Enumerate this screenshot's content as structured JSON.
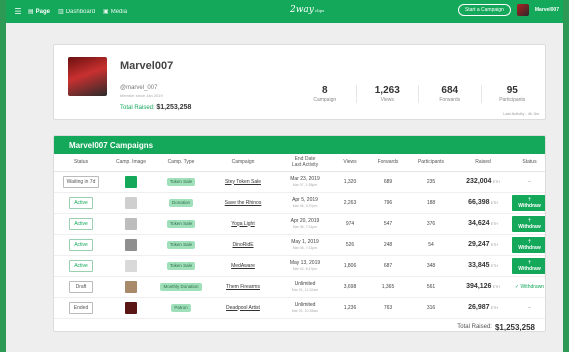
{
  "topbar": {
    "nav": [
      {
        "label": "Page",
        "icon": "page-icon",
        "active": true
      },
      {
        "label": "Dashboard",
        "icon": "bar-chart-icon",
        "active": false
      },
      {
        "label": "Media",
        "icon": "media-icon",
        "active": false
      }
    ],
    "logo": "2way",
    "logo_sub": "clips",
    "start_campaign": "Start a Campaign",
    "username": "Marvel007"
  },
  "profile": {
    "name": "Marvel007",
    "handle": "@marvel_007",
    "member_since": "Member since Jan 2019",
    "total_raised_label": "Total Raised:",
    "total_raised_value": "$1,253,258",
    "stats": [
      {
        "value": "8",
        "label": "Campaign"
      },
      {
        "value": "1,263",
        "label": "Views"
      },
      {
        "value": "684",
        "label": "Forwards"
      },
      {
        "value": "95",
        "label": "Participants"
      }
    ],
    "last_activity": "Last Activity - 4h 3m"
  },
  "campaigns": {
    "title": "Marvel007 Campaigns",
    "headers": [
      "Status",
      "Camp. Image",
      "Camp. Type",
      "Campaign",
      "End Date\nLast Activity",
      "Views",
      "Forwards",
      "Participants",
      "Raised",
      "Status"
    ],
    "rows": [
      {
        "status": "Waiting in 7d",
        "status_kind": "waiting",
        "img_color": "#14a85a",
        "type": "Token Sale",
        "name": "Stey Token Sale",
        "date": "Mar 23, 2019",
        "date_sub": "Mar 07, 1:38pm",
        "views": "1,320",
        "forwards": "689",
        "participants": "235",
        "raised": "232,004",
        "unit": "ETH",
        "action": "–",
        "action_kind": "dash"
      },
      {
        "status": "Active",
        "status_kind": "active",
        "img_color": "#cfcfcf",
        "type": "Donation",
        "name": "Save the Rhinos",
        "date": "Apr 5, 2019",
        "date_sub": "Mar 06, 3:37pm",
        "views": "2,263",
        "forwards": "796",
        "participants": "188",
        "raised": "66,398",
        "unit": "ETH",
        "action": "⇡ Withdraw",
        "action_kind": "button"
      },
      {
        "status": "Active",
        "status_kind": "active",
        "img_color": "#bdbdbd",
        "type": "Token Sale",
        "name": "Yoga Light",
        "date": "Apr 20, 2019",
        "date_sub": "Mar 06, 7:31pm",
        "views": "974",
        "forwards": "547",
        "participants": "376",
        "raised": "34,624",
        "unit": "ETH",
        "action": "⇡ Withdraw",
        "action_kind": "button"
      },
      {
        "status": "Active",
        "status_kind": "active",
        "img_color": "#8f8f8f",
        "type": "Token Sale",
        "name": "DinoRidE",
        "date": "May 1, 2019",
        "date_sub": "Mar 06, 7:31pm",
        "views": "526",
        "forwards": "248",
        "participants": "54",
        "raised": "29,247",
        "unit": "ETH",
        "action": "⇡ Withdraw",
        "action_kind": "button"
      },
      {
        "status": "Active",
        "status_kind": "active",
        "img_color": "#d9d9d9",
        "type": "Token Sale",
        "name": "MedAware",
        "date": "May 13, 2019",
        "date_sub": "Mar 02, 5:47pm",
        "views": "1,806",
        "forwards": "687",
        "participants": "348",
        "raised": "33,845",
        "unit": "ETH",
        "action": "⇡ Withdraw",
        "action_kind": "button"
      },
      {
        "status": "Draft",
        "status_kind": "draft",
        "img_color": "#a88a6a",
        "type": "Monthly Donation",
        "name": "Them Firearms",
        "date": "Unlimited",
        "date_sub": "Mar 01, 11:32am",
        "views": "3,698",
        "forwards": "1,365",
        "participants": "561",
        "raised": "394,126",
        "unit": "ETH",
        "action": "✓ Withdrawn",
        "action_kind": "withdrawn"
      },
      {
        "status": "Ended",
        "status_kind": "ended",
        "img_color": "#5a1515",
        "type": "Patron",
        "name": "Deadpool Artist",
        "date": "Unlimited",
        "date_sub": "Mar 01, 10:28am",
        "views": "1,236",
        "forwards": "763",
        "participants": "316",
        "raised": "26,987",
        "unit": "ETH",
        "action": "–",
        "action_kind": "dash"
      }
    ],
    "total_label": "Total Raised:",
    "total_value": "$1,253,258"
  },
  "colors": {
    "accent": "#14a85a"
  }
}
